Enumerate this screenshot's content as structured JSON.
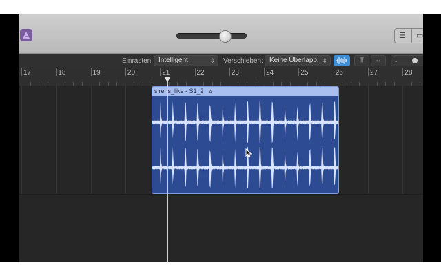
{
  "toolbar": {
    "snap_label": "Einrasten:",
    "snap_value": "Intelligent",
    "drag_label": "Verschieben:",
    "drag_value": "Keine Überlapp.",
    "zoom_level": 0.7
  },
  "ruler": {
    "bars": [
      "17",
      "18",
      "19",
      "20",
      "21",
      "22",
      "23",
      "24",
      "25",
      "26",
      "27",
      "28"
    ]
  },
  "region": {
    "name": "sirens_like - S1_2",
    "loop_icon": "loop-icon"
  },
  "colors": {
    "region_fill": "#2d4b92",
    "region_header": "#a9bff0",
    "waveform": "#d8e3ff",
    "accent_active": "#3e8ed8"
  },
  "icons": {
    "app": "app-icon",
    "list_view": "list-view-icon",
    "window": "window-icon",
    "waveform": "waveform-icon",
    "align": "align-icon",
    "fit": "fit-width-icon",
    "vertical_zoom": "vertical-zoom-icon"
  }
}
